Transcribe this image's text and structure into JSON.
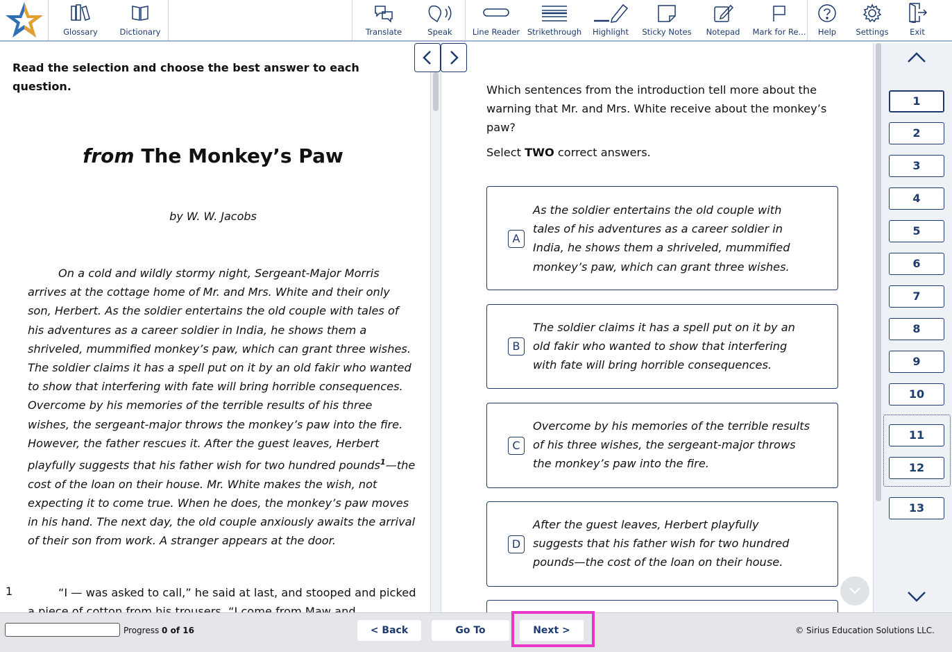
{
  "toolbar": {
    "left_tools": [
      {
        "label": "Glossary",
        "icon": "books-icon"
      },
      {
        "label": "Dictionary",
        "icon": "book-icon"
      }
    ],
    "right_tools": [
      {
        "label": "Translate",
        "icon": "translate-icon"
      },
      {
        "label": "Speak",
        "icon": "speak-icon"
      },
      {
        "label": "Line Reader",
        "icon": "line-reader-icon"
      },
      {
        "label": "Strikethrough",
        "icon": "strikethrough-icon"
      },
      {
        "label": "Highlight",
        "icon": "highlight-icon"
      },
      {
        "label": "Sticky Notes",
        "icon": "sticky-note-icon"
      },
      {
        "label": "Notepad",
        "icon": "notepad-icon"
      },
      {
        "label": "Mark for Re...",
        "icon": "flag-icon"
      },
      {
        "label": "Help",
        "icon": "help-icon"
      },
      {
        "label": "Settings",
        "icon": "gear-icon"
      },
      {
        "label": "Exit",
        "icon": "exit-icon"
      }
    ]
  },
  "passage": {
    "instructions": "Read the selection and choose the best answer to each question.",
    "title_prefix": "from",
    "title_main": "The Monkey’s Paw",
    "author": "by W. W. Jacobs",
    "intro_part1": "On a cold and wildly stormy night, Sergeant-Major Morris arrives at the cottage home of Mr. and Mrs. White and their only son, Herbert. As the soldier entertains the old couple with tales of his adventures as a career soldier in India, he shows them a shriveled, mummified monkey’s paw, which can grant three wishes. The soldier claims it has a spell put on it by an old fakir who wanted to show that interfering with fate will bring horrible consequences. Overcome by his memories of the terrible results of his three wishes, the sergeant-major throws the monkey’s paw into the fire. However, the father rescues it. After the guest leaves, Herbert playfully suggests that his father wish for two hundred pounds",
    "footnote_marker": "1",
    "intro_part2": "—the cost of the loan on their house. Mr. White makes the wish, not expecting it to come true. When he does, the monkey’s paw moves in his hand. The next day, the old couple anxiously awaits the arrival of their son from work. A stranger appears at the door.",
    "paragraph_number": "1",
    "paragraph_1": "“I — was asked to call,” he said at last, and stooped and picked a piece of cotton from his trousers. “I come from Maw and"
  },
  "question": {
    "stem": "Which sentences from the introduction tell more about the warning that Mr. and Mrs. White receive about the monkey’s paw?",
    "select_prefix": "Select ",
    "select_count": "TWO",
    "select_suffix": " correct answers.",
    "choices": [
      {
        "letter": "A",
        "text": "As the soldier entertains the old couple with tales of his adventures as a career soldier in India, he shows them a shriveled, mummified monkey’s paw, which can grant three wishes."
      },
      {
        "letter": "B",
        "text": "The soldier claims it has a spell put on it by an old fakir who wanted to show that interfering with fate will bring horrible consequences."
      },
      {
        "letter": "C",
        "text": "Overcome by his memories of the terrible results of his three wishes, the sergeant-major throws the monkey’s paw into the fire."
      },
      {
        "letter": "D",
        "text": "After the guest leaves, Herbert playfully suggests that his father wish for two hundred pounds—the cost of the loan on their house."
      }
    ]
  },
  "question_nav": {
    "numbers": [
      "1",
      "2",
      "3",
      "4",
      "5",
      "6",
      "7",
      "8",
      "9",
      "10",
      "11",
      "12",
      "13"
    ],
    "current": "1"
  },
  "footer": {
    "progress_label": "Progress",
    "progress_value": "0 of 16",
    "progress_fraction": 0,
    "back_label": "< Back",
    "goto_label": "Go To",
    "next_label": "Next >",
    "copyright": "© Sirius Education Solutions LLC."
  },
  "colors": {
    "accent": "#1d3b6e",
    "highlight": "#e838c7",
    "logo_blue": "#2f6fb4",
    "logo_orange": "#f5a623"
  }
}
